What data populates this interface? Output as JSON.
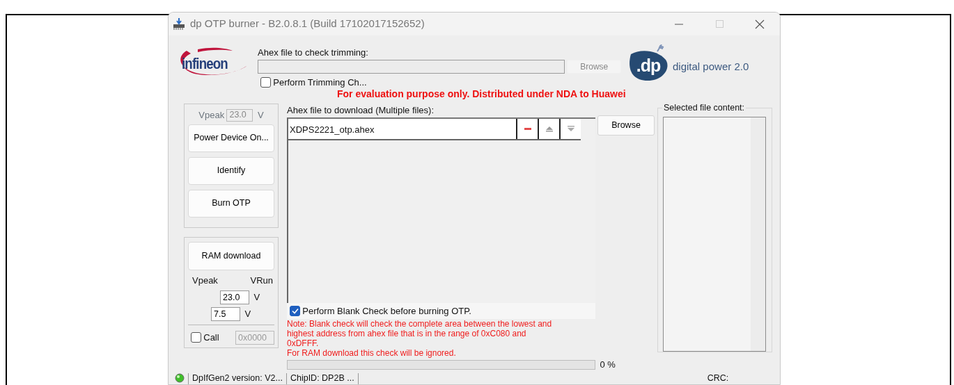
{
  "window": {
    "title": "dp OTP burner - B2.0.8.1 (Build 17102017152652)"
  },
  "logos": {
    "company": "infineon",
    "mark": ".dp",
    "product": "digital power 2.0"
  },
  "trimming": {
    "label": "Ahex file to check trimming:",
    "browse": {
      "label": "Browse",
      "disabled": true
    },
    "checkbox": {
      "label": "Perform Trimming Ch...",
      "checked": false
    }
  },
  "notice": "For evaluation purpose only. Distributed under NDA to Huawei",
  "otp_panel": {
    "vpeak": {
      "label": "Vpeak",
      "value": "23.0",
      "unit": "V",
      "disabled": true
    },
    "buttons": [
      "Power Device On...",
      "Identify",
      "Burn OTP"
    ]
  },
  "ram_panel": {
    "button": "RAM download",
    "headers": [
      "Vpeak",
      "VRun"
    ],
    "fields": [
      {
        "value": "23.0",
        "unit": "V"
      },
      {
        "value": "7.5",
        "unit": "V"
      }
    ],
    "call": {
      "label": "Call",
      "checked": false
    },
    "address": {
      "value": "0x0000",
      "disabled": true
    }
  },
  "download": {
    "label": "Ahex file to download (Multiple files):",
    "files": [
      {
        "name": "XDPS2221_otp.ahex"
      }
    ],
    "browse": "Browse"
  },
  "blank_check": {
    "label": "Perform Blank Check before burning OTP.",
    "checked": true
  },
  "note": [
    "Note: Blank check will check the complete area between the lowest and",
    "highest address from ahex file that is in the range of 0xC080 and",
    "0xDFFF.",
    "For RAM download this check will be ignored."
  ],
  "progress": {
    "level": 0,
    "reading": "0 %"
  },
  "selected_content": {
    "label": "Selected file content:"
  },
  "status_bar": {
    "connected": true,
    "fields": [
      "DpIfGen2 version: V2...",
      "ChipID: DP2B ...",
      "CRC:"
    ]
  }
}
